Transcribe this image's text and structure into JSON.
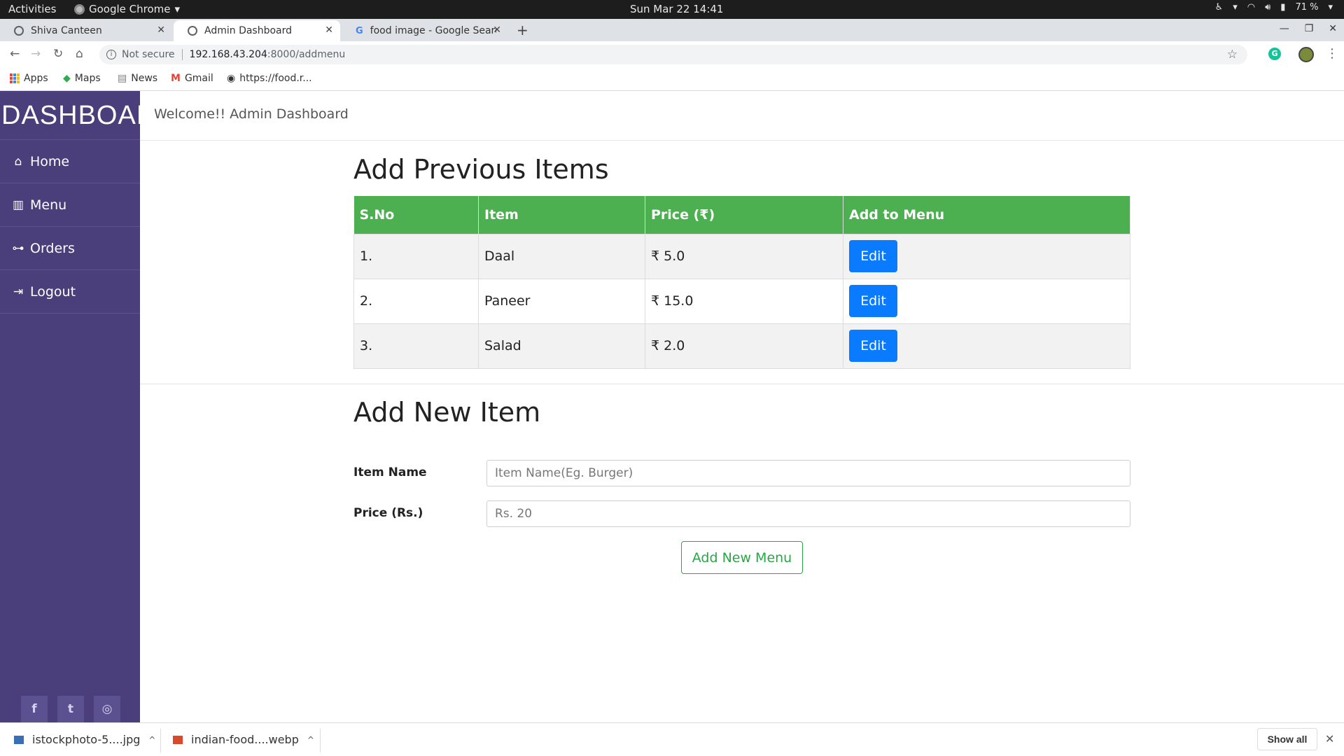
{
  "system_bar": {
    "activities": "Activities",
    "app_name": "Google Chrome",
    "datetime": "Sun Mar 22  14:41",
    "battery": "71 %"
  },
  "tabs": [
    {
      "label": "Shiva Canteen"
    },
    {
      "label": "Admin Dashboard"
    },
    {
      "label": "food image - Google Search"
    }
  ],
  "address_bar": {
    "security": "Not secure",
    "host": "192.168.43.204",
    "path": ":8000/addmenu"
  },
  "bookmarks": [
    {
      "label": "Apps"
    },
    {
      "label": "Maps"
    },
    {
      "label": "News"
    },
    {
      "label": "Gmail"
    },
    {
      "label": "https://food.r..."
    }
  ],
  "sidebar": {
    "brand": "DASHBOARD",
    "items": [
      {
        "label": "Home",
        "icon": "home-icon"
      },
      {
        "label": "Menu",
        "icon": "book-icon"
      },
      {
        "label": "Orders",
        "icon": "sitemap-icon"
      },
      {
        "label": "Logout",
        "icon": "sign-out-icon"
      }
    ],
    "socials": [
      "facebook-icon",
      "twitter-icon",
      "instagram-icon"
    ]
  },
  "header": {
    "welcome": "Welcome!! Admin Dashboard"
  },
  "previous_items": {
    "title": "Add Previous Items",
    "columns": [
      "S.No",
      "Item",
      "Price (₹)",
      "Add to Menu"
    ],
    "rows": [
      {
        "sno": "1.",
        "item": "Daal",
        "price": "₹ 5.0",
        "action": "Edit"
      },
      {
        "sno": "2.",
        "item": "Paneer",
        "price": "₹ 15.0",
        "action": "Edit"
      },
      {
        "sno": "3.",
        "item": "Salad",
        "price": "₹ 2.0",
        "action": "Edit"
      }
    ]
  },
  "new_item": {
    "title": "Add New Item",
    "name_label": "Item Name",
    "name_placeholder": "Item Name(Eg. Burger)",
    "price_label": "Price (Rs.)",
    "price_placeholder": "Rs. 20",
    "submit_label": "Add New Menu"
  },
  "downloads": {
    "files": [
      {
        "name": "istockphoto-5....jpg"
      },
      {
        "name": "indian-food....webp"
      }
    ],
    "show_all": "Show all"
  },
  "colors": {
    "sidebar": "#4a3f7a",
    "table_header": "#4caf50",
    "edit_button": "#0a7bff",
    "add_button": "#28a745"
  }
}
